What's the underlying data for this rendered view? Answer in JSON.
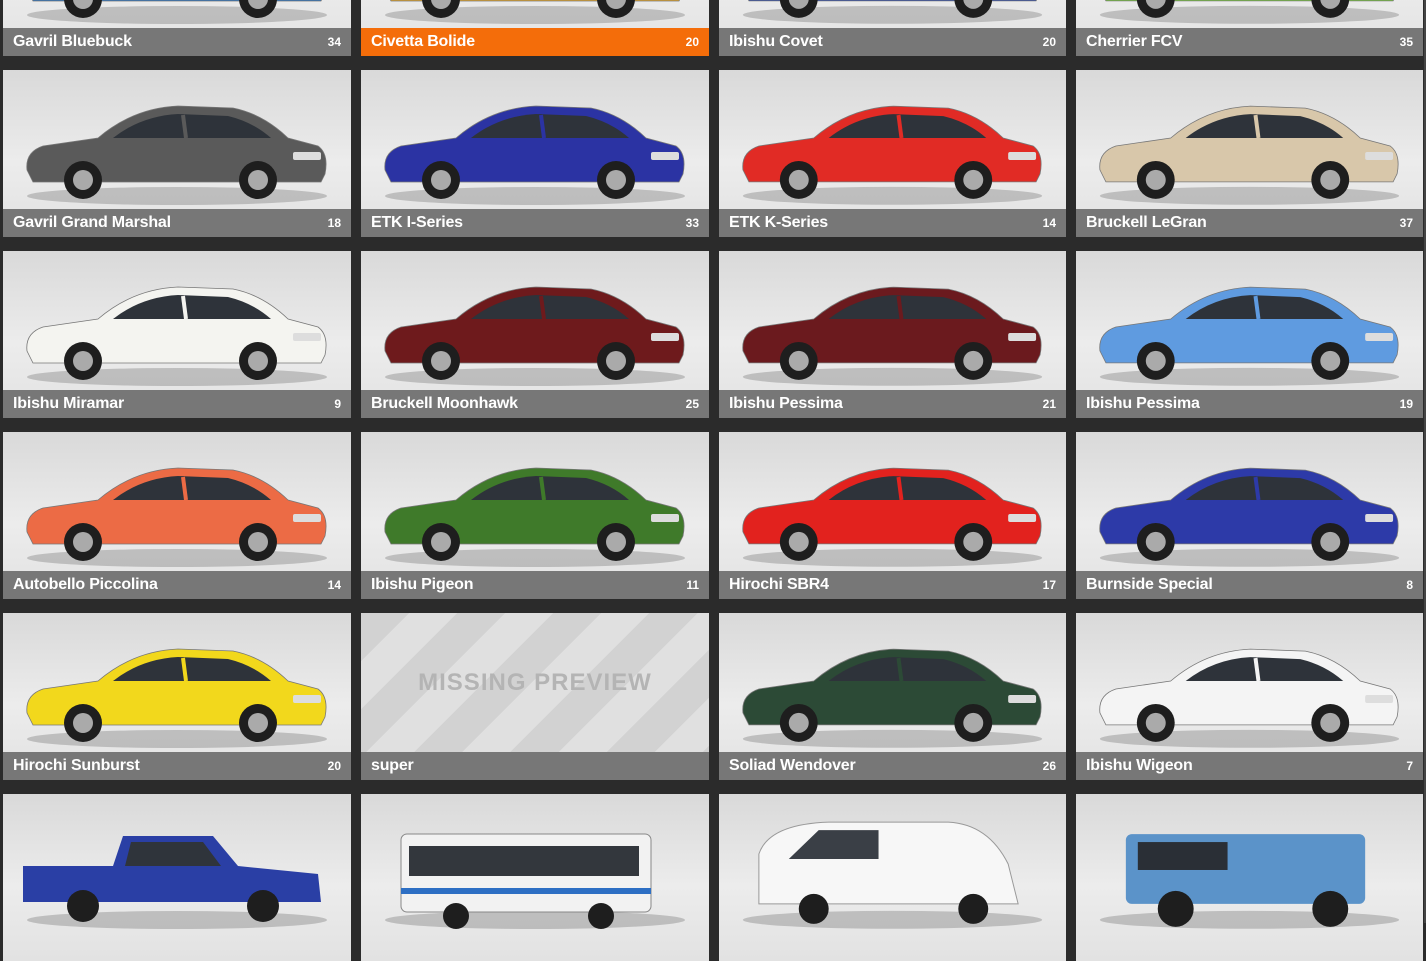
{
  "vehicles": [
    {
      "name": "Gavril Bluebuck",
      "count": "34",
      "color": "#2a6fb8",
      "icon": "car-preview-icon"
    },
    {
      "name": "Civetta Bolide",
      "count": "20",
      "color": "#e0a020",
      "icon": "car-preview-icon",
      "selected": true
    },
    {
      "name": "Ibishu Covet",
      "count": "20",
      "color": "#1f3fa8",
      "icon": "car-preview-icon"
    },
    {
      "name": "Cherrier FCV",
      "count": "35",
      "color": "#6fce2a",
      "icon": "car-preview-icon"
    },
    {
      "name": "Gavril Grand Marshal",
      "count": "18",
      "color": "#5a5a5a",
      "icon": "car-preview-icon"
    },
    {
      "name": "ETK I-Series",
      "count": "33",
      "color": "#2b33a3",
      "icon": "car-preview-icon"
    },
    {
      "name": "ETK K-Series",
      "count": "14",
      "color": "#e12b25",
      "icon": "car-preview-icon"
    },
    {
      "name": "Bruckell LeGran",
      "count": "37",
      "color": "#d8c7aa",
      "icon": "car-preview-icon"
    },
    {
      "name": "Ibishu Miramar",
      "count": "9",
      "color": "#f4f4f0",
      "icon": "car-preview-icon"
    },
    {
      "name": "Bruckell Moonhawk",
      "count": "25",
      "color": "#6e1a1c",
      "icon": "car-preview-icon"
    },
    {
      "name": "Ibishu Pessima",
      "count": "21",
      "color": "#6b1a1e",
      "icon": "car-preview-icon"
    },
    {
      "name": "Ibishu Pessima",
      "count": "19",
      "color": "#5f9be0",
      "icon": "car-preview-icon"
    },
    {
      "name": "Autobello Piccolina",
      "count": "14",
      "color": "#ec6b45",
      "icon": "car-preview-icon"
    },
    {
      "name": "Ibishu Pigeon",
      "count": "11",
      "color": "#3f7a2a",
      "icon": "car-preview-icon"
    },
    {
      "name": "Hirochi SBR4",
      "count": "17",
      "color": "#e2221e",
      "icon": "car-preview-icon"
    },
    {
      "name": "Burnside Special",
      "count": "8",
      "color": "#2d3aa8",
      "icon": "car-preview-icon"
    },
    {
      "name": "Hirochi Sunburst",
      "count": "20",
      "color": "#f2d81c",
      "icon": "car-preview-icon"
    },
    {
      "name": "super",
      "count": "",
      "missing": true,
      "missing_label": "MISSING PREVIEW",
      "icon": "missing-preview-icon"
    },
    {
      "name": "Soliad Wendover",
      "count": "26",
      "color": "#2c4a36",
      "icon": "car-preview-icon"
    },
    {
      "name": "Ibishu Wigeon",
      "count": "7",
      "color": "#f4f4f4",
      "icon": "car-preview-icon"
    },
    {
      "name": "",
      "count": "",
      "color": "#2a3fa5",
      "icon": "pickup-preview-icon"
    },
    {
      "name": "",
      "count": "",
      "color": "#f2f2f2",
      "icon": "bus-preview-icon"
    },
    {
      "name": "",
      "count": "",
      "color": "#f7f7f7",
      "icon": "van-preview-icon"
    },
    {
      "name": "",
      "count": "",
      "color": "#5b93c9",
      "icon": "suv-preview-icon"
    }
  ]
}
